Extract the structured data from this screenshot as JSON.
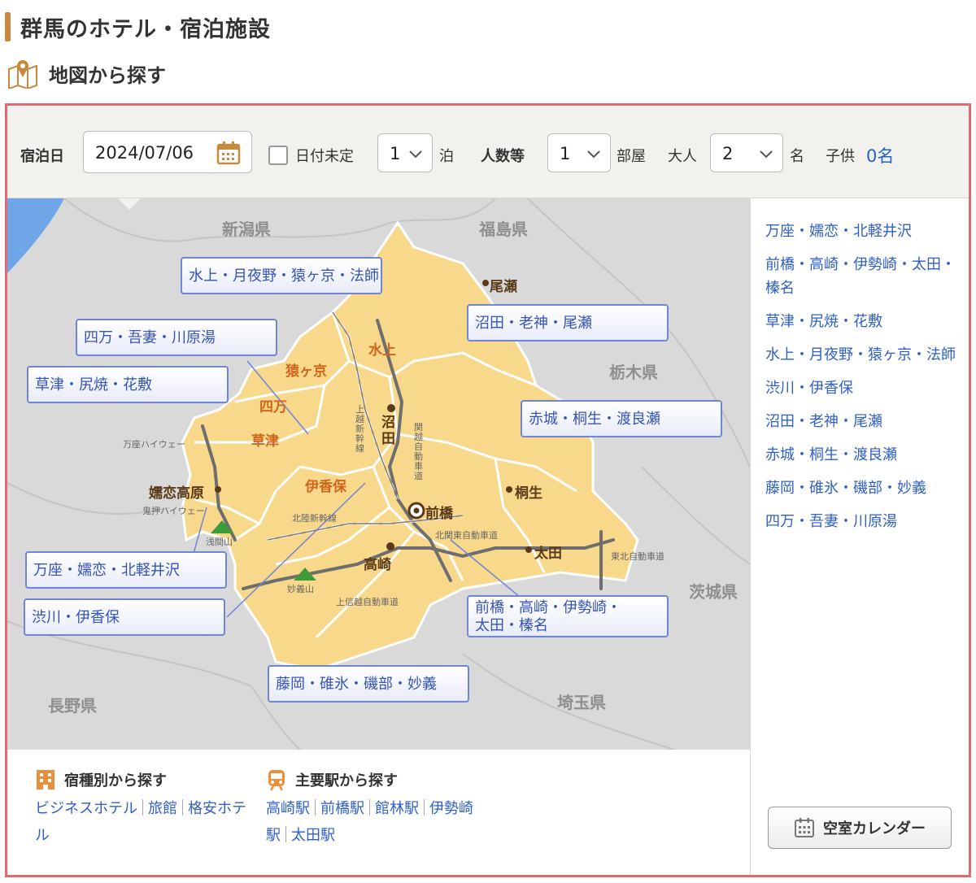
{
  "page": {
    "title": "群馬のホテル・宿泊施設",
    "subtitle": "地図から探す",
    "subtitle_icon": "map-pin-icon"
  },
  "search": {
    "checkin_label": "宿泊日",
    "checkin_value": "2024/07/06",
    "calendar_icon": "calendar-icon",
    "date_undecided_label": "日付未定",
    "nights_value": "1",
    "nights_unit": "泊",
    "guests_label": "人数等",
    "rooms_value": "1",
    "rooms_unit": "部屋",
    "adults_label": "大人",
    "adults_value": "2",
    "adults_unit": "名",
    "children_label": "子供",
    "children_value": "0名"
  },
  "map": {
    "prefectures": [
      "新潟県",
      "福島県",
      "栃木県",
      "茨城県",
      "埼玉県",
      "長野県"
    ],
    "area_buttons": [
      "水上・月夜野・猿ヶ京・法師",
      "沼田・老神・尾瀬",
      "四万・吾妻・川原湯",
      "草津・尻焼・花敷",
      "赤城・桐生・渡良瀬",
      "万座・嬬恋・北軽井沢",
      "渋川・伊香保",
      "前橋・高崎・伊勢崎・",
      "太田・榛名",
      "藤岡・碓氷・磯部・妙義"
    ],
    "towns": [
      "尾瀬",
      "沼田",
      "前橋",
      "高崎",
      "桐生",
      "太田",
      "嬬恋高原"
    ],
    "onsens": [
      "水上",
      "猿ヶ京",
      "四万",
      "草津",
      "伊香保"
    ],
    "roads": [
      "万座ハイウェー",
      "鬼押ハイウェー",
      "浅間山",
      "妙義山",
      "上越新幹線",
      "関越自動車道",
      "北陸新幹線",
      "北関東自動車道",
      "上信越自動車道",
      "東北自動車道"
    ]
  },
  "area_list": [
    "万座・嬬恋・北軽井沢",
    "前橋・高崎・伊勢崎・太田・榛名",
    "草津・尻焼・花敷",
    "水上・月夜野・猿ヶ京・法師",
    "渋川・伊香保",
    "沼田・老神・尾瀬",
    "赤城・桐生・渡良瀬",
    "藤岡・碓氷・磯部・妙義",
    "四万・吾妻・川原湯"
  ],
  "vacancy_button": {
    "label": "空室カレンダー",
    "icon": "calendar-icon"
  },
  "by_type": {
    "heading": "宿種別から探す",
    "icon": "building-icon",
    "links": [
      "ビジネスホテル",
      "旅館",
      "格安ホテル"
    ]
  },
  "by_station": {
    "heading": "主要駅から探す",
    "icon": "train-icon",
    "links": [
      "高崎駅",
      "前橋駅",
      "館林駅",
      "伊勢崎駅",
      "太田駅"
    ]
  },
  "colors": {
    "accent": "#c8893e",
    "frame_border": "#e06a72",
    "link": "#2f5fc8",
    "map_land": "#f8d88a",
    "area_button_border": "#6f86d6"
  }
}
